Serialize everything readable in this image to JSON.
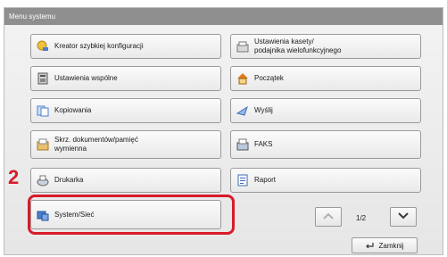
{
  "window": {
    "title": "Menu systemu"
  },
  "menu": {
    "quick_setup": "Kreator szybkiej konfiguracji",
    "cassette_settings": "Ustawienia kasety/\npodajnika wielofunkcyjnego",
    "common_settings": "Ustawienia wspólne",
    "home": "Początek",
    "copy": "Kopiowania",
    "send": "Wyślij",
    "document_box": "Skrz. dokumentów/pamięć\nwymienna",
    "fax": "FAKS",
    "printer": "Drukarka",
    "report": "Raport",
    "system_network": "System/Sieć"
  },
  "callout": {
    "step_number": "2"
  },
  "pagination": {
    "page": "1/2"
  },
  "footer": {
    "close_label": "Zamknij"
  },
  "colors": {
    "highlight": "#d81b2a",
    "titlebar": "#8f8f8f"
  }
}
